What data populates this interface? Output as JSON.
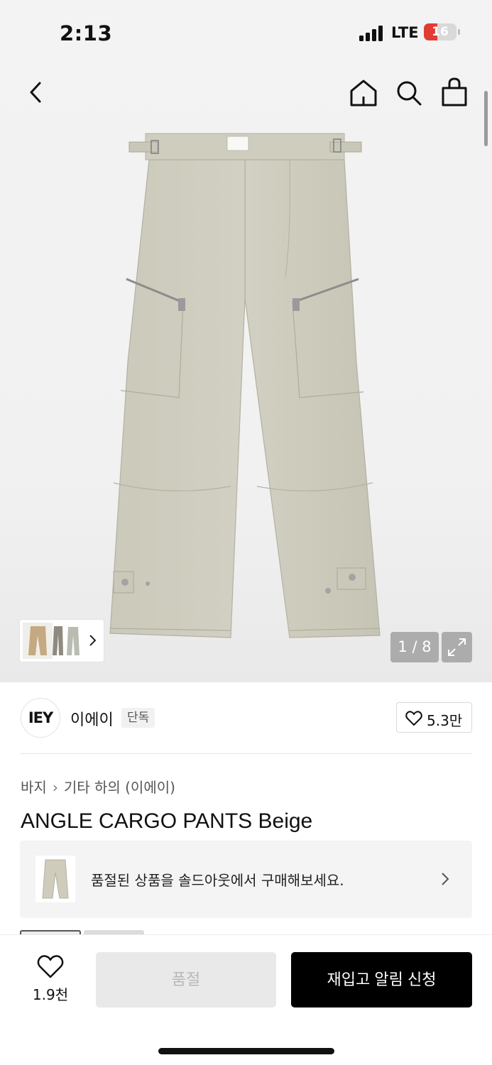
{
  "status_bar": {
    "time": "2:13",
    "network": "LTE",
    "battery_level": "16",
    "battery_fraction": 0.16,
    "battery_color": "#e23b36"
  },
  "nav": {
    "back_icon": "chevron-left-icon",
    "home_icon": "home-icon",
    "search_icon": "search-icon",
    "cart_icon": "shopping-bag-icon"
  },
  "gallery": {
    "counter": "1 / 8",
    "expand_icon": "expand-icon"
  },
  "brand": {
    "logo_text": "IEY",
    "name": "이에이",
    "badge": "단독",
    "like_count": "5.3만"
  },
  "breadcrumb": {
    "items": [
      "바지",
      "기타 하의 (이에이)"
    ]
  },
  "product": {
    "title": "ANGLE CARGO PANTS Beige",
    "color": "#c8c6b6"
  },
  "soldout_banner": {
    "text": "품절된 상품을 솔드아웃에서 구매해보세요."
  },
  "bottom_bar": {
    "wish_count": "1.9천",
    "soldout_label": "품절",
    "restock_label": "재입고 알림 신청"
  }
}
